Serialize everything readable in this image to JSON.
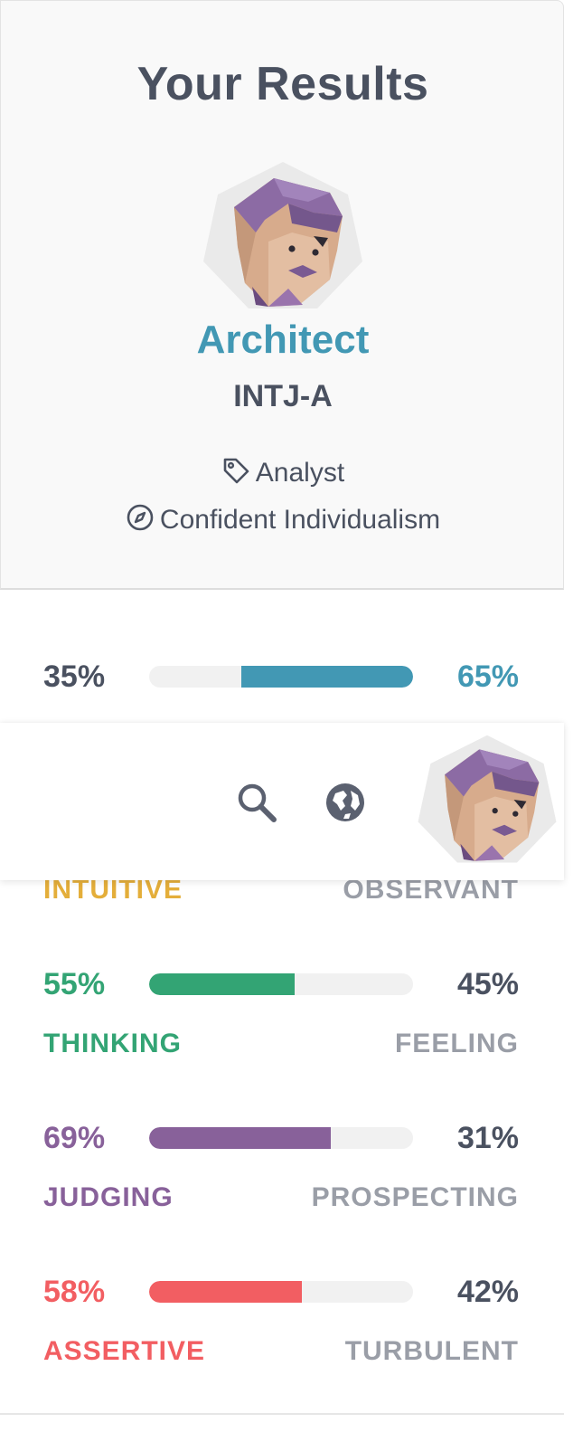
{
  "header": {
    "title": "Your Results",
    "avatar_icon": "architect-avatar-icon"
  },
  "result": {
    "type_name": "Architect",
    "type_code": "INTJ-A",
    "role_icon": "tag-icon",
    "role": "Analyst",
    "strategy_icon": "compass-icon",
    "strategy": "Confident Individualism"
  },
  "colors": {
    "mind": "#4298b4",
    "energy": "#e4ae3a",
    "nature": "#33a474",
    "tactics": "#88619a",
    "identity": "#f25e62",
    "text_dark": "#4a5160",
    "text_muted": "#9a9ea7"
  },
  "scales": [
    {
      "left_pct": "35%",
      "right_pct": "65%",
      "value": 65,
      "dominant": "right",
      "left_label": "",
      "right_label": "",
      "color": "#4298b4"
    },
    {
      "left_pct": "",
      "right_pct": "",
      "dominant": "left",
      "left_label": "INTUITIVE",
      "right_label": "OBSERVANT",
      "color": "#e4ae3a"
    },
    {
      "left_pct": "55%",
      "right_pct": "45%",
      "value": 55,
      "dominant": "left",
      "left_label": "THINKING",
      "right_label": "FEELING",
      "color": "#33a474"
    },
    {
      "left_pct": "69%",
      "right_pct": "31%",
      "value": 69,
      "dominant": "left",
      "left_label": "JUDGING",
      "right_label": "PROSPECTING",
      "color": "#88619a"
    },
    {
      "left_pct": "58%",
      "right_pct": "42%",
      "value": 58,
      "dominant": "left",
      "left_label": "ASSERTIVE",
      "right_label": "TURBULENT",
      "color": "#f25e62"
    }
  ],
  "toolbar": {
    "search_icon": "search-icon",
    "globe_icon": "globe-icon",
    "avatar_icon": "architect-avatar-icon"
  }
}
